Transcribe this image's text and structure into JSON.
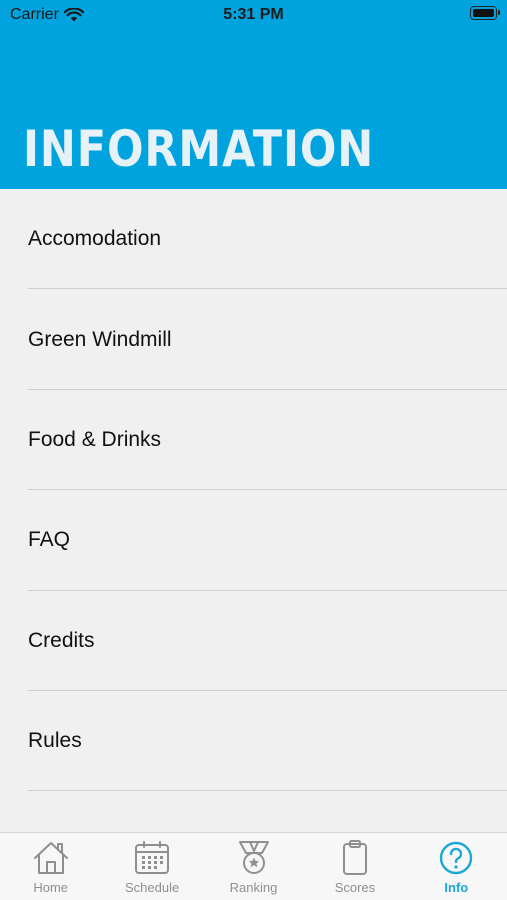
{
  "status_bar": {
    "carrier": "Carrier",
    "time": "5:31 PM",
    "icons": [
      "wifi-icon",
      "battery-icon"
    ]
  },
  "header": {
    "title": "INFORMATION",
    "background_color": "#00a3dd"
  },
  "info_list": [
    {
      "label": "Accomodation"
    },
    {
      "label": "Green Windmill"
    },
    {
      "label": "Food & Drinks"
    },
    {
      "label": "FAQ"
    },
    {
      "label": "Credits"
    },
    {
      "label": "Rules"
    }
  ],
  "tab_bar": {
    "selected": "Info",
    "active_color": "#1aa8d6",
    "inactive_color": "#8f8f8f",
    "tabs": [
      {
        "label": "Home",
        "icon": "home-icon"
      },
      {
        "label": "Schedule",
        "icon": "calendar-icon"
      },
      {
        "label": "Ranking",
        "icon": "medal-icon"
      },
      {
        "label": "Scores",
        "icon": "clipboard-icon"
      },
      {
        "label": "Info",
        "icon": "question-circle-icon"
      }
    ]
  }
}
